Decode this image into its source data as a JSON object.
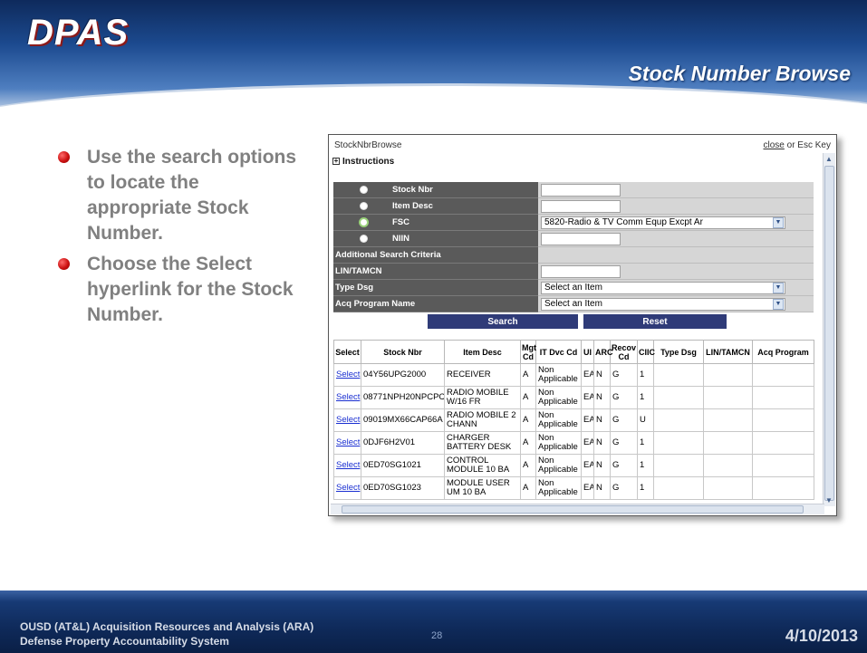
{
  "header": {
    "logo_text": "DPAS",
    "slide_title": "Stock Number Browse"
  },
  "bullets": [
    "Use the search options to locate the appropriate Stock Number.",
    "Choose the Select  hyperlink for the Stock Number."
  ],
  "window": {
    "title": "StockNbrBrowse",
    "close_link": "close",
    "close_suffix": " or Esc Key",
    "instructions_label": "Instructions"
  },
  "search_form": {
    "stock_nbr_label": "Stock Nbr",
    "item_desc_label": "Item Desc",
    "fsc_label": "FSC",
    "fsc_value": "5820-Radio & TV Comm Equp Excpt Ar",
    "niin_label": "NIIN",
    "additional_label": "Additional Search Criteria",
    "lin_tamcn_label": "LIN/TAMCN",
    "type_dsg_label": "Type Dsg",
    "type_dsg_value": "Select an Item",
    "acq_program_label": "Acq Program Name",
    "acq_program_value": "Select an Item",
    "selected_radio": "FSC"
  },
  "buttons": {
    "search": "Search",
    "reset": "Reset"
  },
  "grid": {
    "columns": [
      "Select",
      "Stock Nbr",
      "Item Desc",
      "Mgt Cd",
      "IT Dvc Cd",
      "UI",
      "ARC",
      "Recov Cd",
      "CIIC",
      "Type Dsg",
      "LIN/TAMCN",
      "Acq Program"
    ],
    "rows": [
      [
        "Select",
        "04Y56UPG2000",
        "RECEIVER",
        "A",
        "Non Applicable",
        "EA",
        "N",
        "G",
        "1",
        "",
        "",
        ""
      ],
      [
        "Select",
        "08771NPH20NPCPC",
        "RADIO MOBILE W/16 FR",
        "A",
        "Non Applicable",
        "EA",
        "N",
        "G",
        "1",
        "",
        "",
        ""
      ],
      [
        "Select",
        "09019MX66CAP66A",
        "RADIO MOBILE 2 CHANN",
        "A",
        "Non Applicable",
        "EA",
        "N",
        "G",
        "U",
        "",
        "",
        ""
      ],
      [
        "Select",
        "0DJF6H2V01",
        "CHARGER BATTERY DESK",
        "A",
        "Non Applicable",
        "EA",
        "N",
        "G",
        "1",
        "",
        "",
        ""
      ],
      [
        "Select",
        "0ED70SG1021",
        "CONTROL MODULE 10 BA",
        "A",
        "Non Applicable",
        "EA",
        "N",
        "G",
        "1",
        "",
        "",
        ""
      ],
      [
        "Select",
        "0ED70SG1023",
        "MODULE USER UM 10 BA",
        "A",
        "Non Applicable",
        "EA",
        "N",
        "G",
        "1",
        "",
        "",
        ""
      ]
    ]
  },
  "footer": {
    "org_line1": "OUSD (AT&L) Acquisition Resources and Analysis (ARA)",
    "org_line2": "Defense Property Accountability System",
    "page_number": "28",
    "date": "4/10/2013"
  },
  "colors": {
    "header_blue": "#1c4a8f",
    "bullet_red": "#cc1111",
    "bullet_text": "#808080",
    "button_navy": "#2f3b78",
    "link_blue": "#1a2fd1"
  }
}
